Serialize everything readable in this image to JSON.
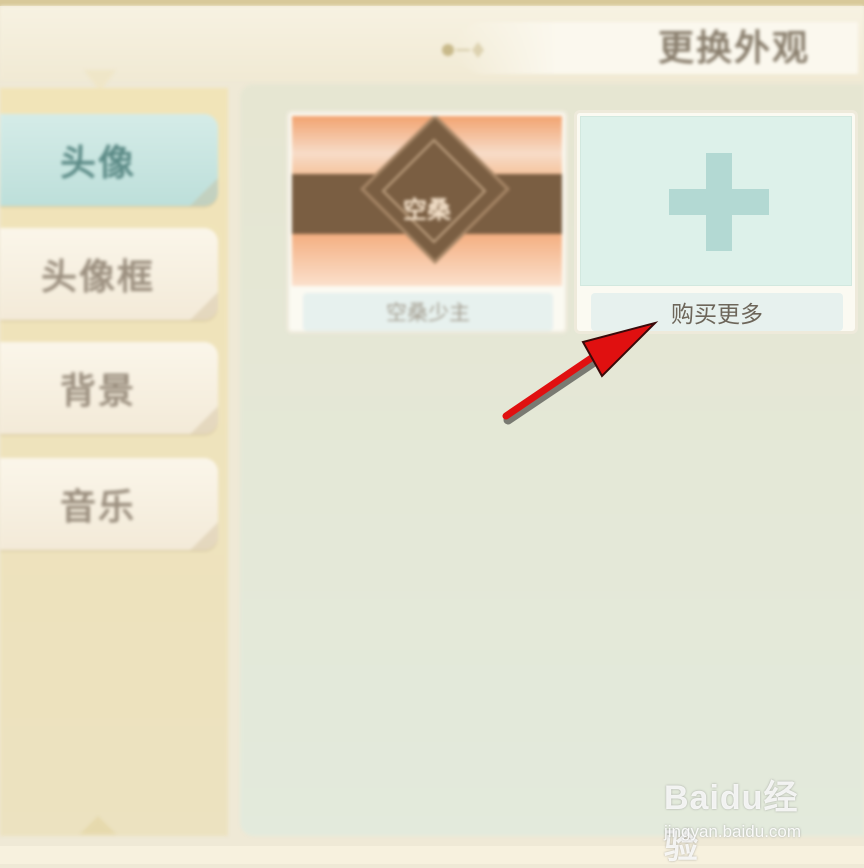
{
  "header": {
    "title": "更换外观"
  },
  "sidebar": {
    "items": [
      {
        "label": "头像",
        "active": true
      },
      {
        "label": "头像框",
        "active": false
      },
      {
        "label": "背景",
        "active": false
      },
      {
        "label": "音乐",
        "active": false
      }
    ]
  },
  "cards": [
    {
      "label": "空桑少主",
      "thumb_text": "空桑"
    },
    {
      "label": "购买更多",
      "icon": "plus-icon"
    }
  ],
  "watermark": {
    "logo": "Baidu经验",
    "url": "jingyan.baidu.com"
  },
  "colors": {
    "active_tab": "#bddfda",
    "inactive_tab": "#f3ead8",
    "sidebar_bg": "#f1e4b8",
    "plus": "#b3d9d3",
    "annotation_arrow": "#e01010"
  }
}
